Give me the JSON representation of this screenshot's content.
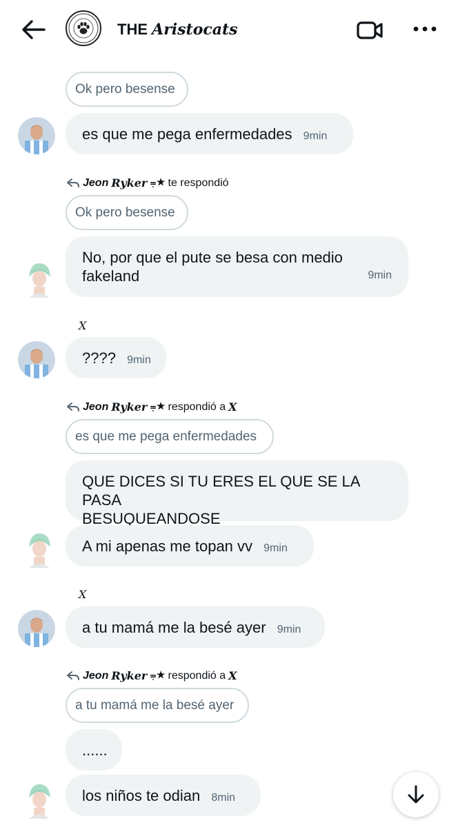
{
  "header": {
    "logo_text": "THE ARISTOCATS",
    "title_prefix": "THE",
    "title_script": "Aristocats",
    "icons": [
      "back-arrow-icon",
      "video-camera-icon",
      "more-dots-icon"
    ]
  },
  "messages": {
    "q1": "Ok pero besense",
    "m1": {
      "text": "es que me pega enfermedades",
      "time": "9min"
    },
    "reply1": {
      "name": "Jeon",
      "name_serif": "Ryker",
      "deco": "⩦★",
      "action": "te respondió"
    },
    "q2": "Ok pero besense",
    "m2": {
      "text_line1": "No, por que el pute se besa con medio",
      "text_line2": "fakeland",
      "time": "9min"
    },
    "x1": "X",
    "m3": {
      "text": "????",
      "time": "9min"
    },
    "reply2": {
      "name": "Jeon",
      "name_serif": "Ryker",
      "deco": "⩦★",
      "action": "respondió a",
      "target": "X"
    },
    "q3": "es que me pega enfermedades",
    "m4": {
      "text_line1": "QUE DICES SI TU ERES EL QUE SE LA PASA",
      "text_line2": "BESUQUEANDOSE"
    },
    "m5": {
      "text": "A mi apenas me topan vv",
      "time": "9min"
    },
    "x2": "X",
    "m6": {
      "text": "a tu mamá me la besé ayer",
      "time": "9min"
    },
    "reply3": {
      "name": "Jeon",
      "name_serif": "Ryker",
      "deco": "⩦★",
      "action": "respondió a",
      "target": "X"
    },
    "q4": "a tu mamá me la besé ayer",
    "m7": {
      "text": "......"
    },
    "m8": {
      "text": "los niños te odian",
      "time": "8min"
    }
  }
}
